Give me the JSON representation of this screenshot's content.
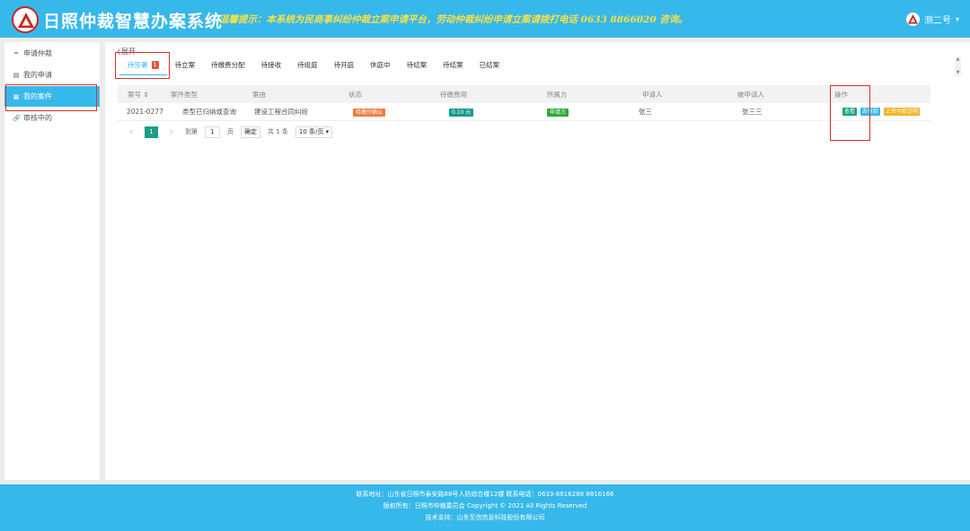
{
  "header": {
    "app_title": "日照仲裁智慧办案系统",
    "notice": "温馨提示：本系统为民商事纠纷仲裁立案申请平台，劳动仲裁纠纷申请立案请拨打电话 0633 8866020 咨询。",
    "user_name": "测二号",
    "caret": "▾"
  },
  "sidebar": {
    "items": [
      {
        "icon": "∞",
        "label": "申请仲裁"
      },
      {
        "icon": "▤",
        "label": "我的申请"
      },
      {
        "icon": "▦",
        "label": "我的案件"
      },
      {
        "icon": "🔗",
        "label": "审核中的"
      }
    ]
  },
  "main": {
    "section_label": "展开",
    "section_label_icon": "《",
    "tabs": [
      {
        "label": "待签署",
        "badge": "1"
      },
      {
        "label": "待立案"
      },
      {
        "label": "待缴费分配"
      },
      {
        "label": "待接收"
      },
      {
        "label": "待组庭"
      },
      {
        "label": "待开庭"
      },
      {
        "label": "休庭中"
      },
      {
        "label": "待结案"
      },
      {
        "label": "待结案"
      },
      {
        "label": "已结案"
      }
    ],
    "scroll_up": "▲",
    "scroll_down": "▼"
  },
  "table": {
    "headers": [
      "案号 ⇕",
      "案件类型",
      "案由",
      "状态",
      "待缴费用",
      "所属方",
      "申请人",
      "被申请人",
      "操作"
    ],
    "rows": [
      {
        "case_no": "2021-0277",
        "case_type": "类型已归纳或查询",
        "cause": "建设工程合同纠纷",
        "status": "待缴付确认",
        "fee": "0.10 元",
        "party": "申请方",
        "applicant": "张三",
        "respondent": "张三三",
        "actions": [
          "查看",
          "去付款",
          "上传付款证明"
        ]
      }
    ]
  },
  "pager": {
    "prev": "<",
    "page": "1",
    "next": ">",
    "goto_label": "到第",
    "goto_value": "1",
    "page_unit": "页",
    "confirm": "确定",
    "total": "共 1 条",
    "page_size": "10 条/页 ▾"
  },
  "footer": {
    "line1": "联系地址：山东省日照市泰安路88号人防综合楼12楼  联系电话：0633-8816288 8816166",
    "line2": "版权所有：日照市仲裁委员会 Copyright © 2021 All Rights Reserved",
    "line3": "技术支持：山东至信信息科技股份有限公司"
  },
  "colors": {
    "primary": "#37b8ea",
    "notice": "#f4e04a",
    "highlight": "#d9302b"
  }
}
